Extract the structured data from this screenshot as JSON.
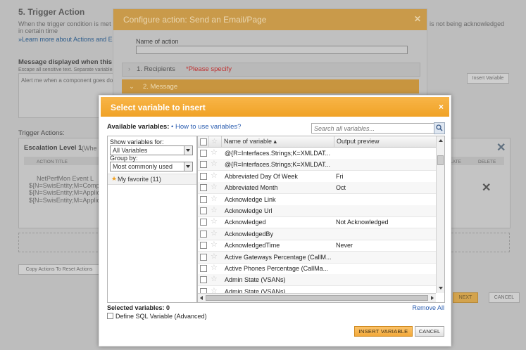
{
  "background": {
    "section_title": "5. Trigger Action",
    "intro_text": "When the trigger condition is met",
    "intro_text_2": "in certain time",
    "intro_right": "is not being acknowledged",
    "learn_more": "»Learn more about Actions and E",
    "message_label": "Message displayed when this al",
    "message_hint": "Escape all sensitive text. Separate variables",
    "message_value": "Alert me when a component goes do",
    "insert_variable": "Insert Variable",
    "trigger_actions_label": "Trigger Actions:",
    "escalation_label": "Escalation Level 1",
    "escalation_suffix": "(Whe",
    "action_title_header": "ACTION TITLE",
    "delay_header": "LATE",
    "delete_header": "DELETE",
    "action_lines": [
      "NetPerfMon Event L",
      "${N=SwisEntity;M=Comp",
      "${N=SwisEntity;M=Applic",
      "${N=SwisEntity;M=Applic"
    ],
    "copy_actions": "Copy Actions To Reset Actions",
    "next_button": "NEXT",
    "cancel_button": "CANCEL"
  },
  "configure_dialog": {
    "title": "Configure action: Send an Email/Page",
    "name_label": "Name of action",
    "name_value": "",
    "step1": "1. Recipients",
    "step1_warning": "*Please specify",
    "step2": "2. Message"
  },
  "select_dialog": {
    "title": "Select variable to insert",
    "available_label": "Available variables:",
    "how_to_link": "• How to use variables?",
    "search_placeholder": "Search all variables...",
    "show_for_label": "Show variables for:",
    "show_for_value": "All Variables",
    "group_by_label": "Group by:",
    "group_by_value": "Most commonly used",
    "favorite_item": "My favorite (11)",
    "col_name": "Name of variable ▴",
    "col_preview": "Output preview",
    "rows": [
      {
        "name": "@{R=Interfaces.Strings;K=XMLDAT...",
        "preview": ""
      },
      {
        "name": "@{R=Interfaces.Strings;K=XMLDAT...",
        "preview": ""
      },
      {
        "name": "Abbreviated Day Of Week",
        "preview": "Fri"
      },
      {
        "name": "Abbreviated Month",
        "preview": "Oct"
      },
      {
        "name": "Acknowledge Link",
        "preview": ""
      },
      {
        "name": "Acknowledge Url",
        "preview": ""
      },
      {
        "name": "Acknowledged",
        "preview": "Not Acknowledged"
      },
      {
        "name": "AcknowledgedBy",
        "preview": ""
      },
      {
        "name": "AcknowledgedTime",
        "preview": "Never"
      },
      {
        "name": "Active Gateways Percentage (CallM...",
        "preview": ""
      },
      {
        "name": "Active Phones Percentage (CallMa...",
        "preview": ""
      },
      {
        "name": "Admin State (VSANs)",
        "preview": ""
      },
      {
        "name": "Admin State (VSANs)",
        "preview": ""
      }
    ],
    "selected_count": "Selected variables: 0",
    "remove_all": "Remove All",
    "sql_option": "Define SQL Variable (Advanced)",
    "insert_button": "INSERT VARIABLE",
    "cancel_button": "CANCEL"
  },
  "colors": {
    "header_orange": "#f0a226",
    "link_blue": "#2a5db0",
    "warning_red": "#c03030"
  }
}
